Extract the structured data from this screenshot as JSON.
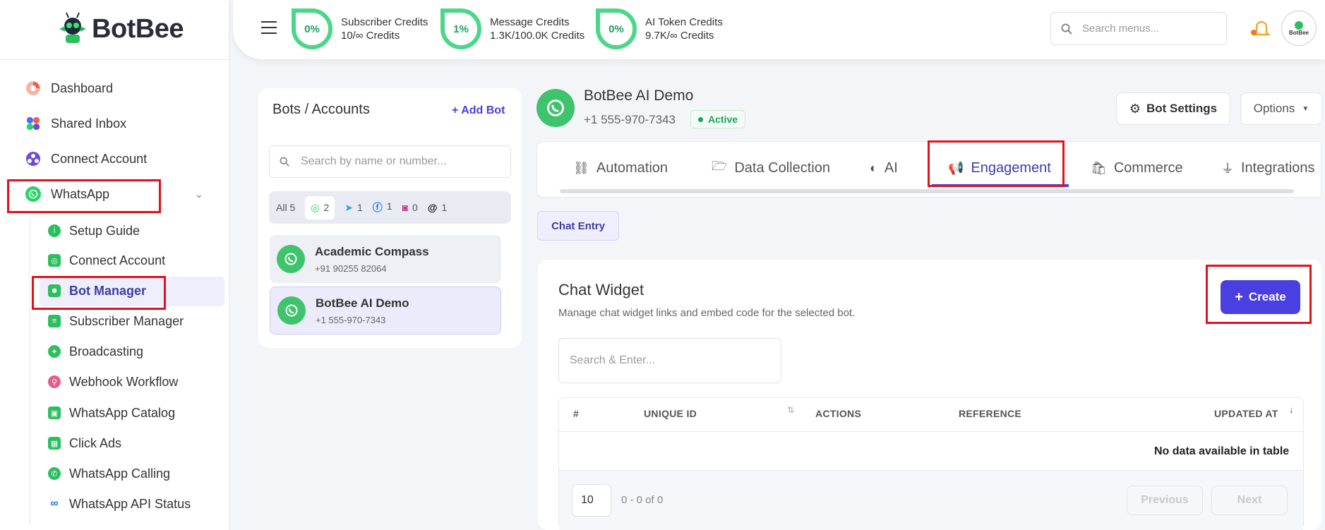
{
  "brand": {
    "name": "BotBee",
    "avatar_text": "BotBee"
  },
  "sidebar": {
    "items": [
      {
        "label": "Dashboard",
        "icon": "dashboard-icon",
        "color": "#f25c54"
      },
      {
        "label": "Shared Inbox",
        "icon": "shared-inbox-icon",
        "color": "#4a6cf7"
      },
      {
        "label": "Connect Account",
        "icon": "connect-account-icon",
        "color": "#6c4cd6"
      },
      {
        "label": "WhatsApp",
        "icon": "whatsapp-icon",
        "color": "#25d366"
      }
    ],
    "whatsapp_sub": [
      {
        "label": "Setup Guide",
        "icon": "info-icon",
        "color": "#2bbf5e"
      },
      {
        "label": "Connect Account",
        "icon": "connect-icon",
        "color": "#2bbf5e"
      },
      {
        "label": "Bot Manager",
        "icon": "robot-icon",
        "color": "#2bbf5e"
      },
      {
        "label": "Subscriber Manager",
        "icon": "subscriber-icon",
        "color": "#2bbf5e"
      },
      {
        "label": "Broadcasting",
        "icon": "broadcast-icon",
        "color": "#2bbf5e"
      },
      {
        "label": "Webhook Workflow",
        "icon": "webhook-icon",
        "color": "#e35d8b"
      },
      {
        "label": "WhatsApp Catalog",
        "icon": "catalog-icon",
        "color": "#2bbf5e"
      },
      {
        "label": "Click Ads",
        "icon": "click-ads-icon",
        "color": "#2bbf5e"
      },
      {
        "label": "WhatsApp Calling",
        "icon": "calling-icon",
        "color": "#2bbf5e"
      },
      {
        "label": "WhatsApp API Status",
        "icon": "meta-icon",
        "color": "#1877f2"
      }
    ]
  },
  "topbar": {
    "credits": [
      {
        "percent": "0%",
        "title": "Subscriber Credits",
        "value": "10/∞ Credits"
      },
      {
        "percent": "1%",
        "title": "Message Credits",
        "value": "1.3K/100.0K Credits"
      },
      {
        "percent": "0%",
        "title": "AI Token Credits",
        "value": "9.7K/∞ Credits"
      }
    ],
    "search_placeholder": "Search menus..."
  },
  "bots": {
    "title": "Bots / Accounts",
    "add_label": "Add Bot",
    "search_placeholder": "Search by name or number...",
    "filters": [
      {
        "label": "All 5"
      },
      {
        "icon": "whatsapp-icon",
        "count": "2"
      },
      {
        "icon": "telegram-icon",
        "count": "1"
      },
      {
        "icon": "facebook-icon",
        "count": "1"
      },
      {
        "icon": "instagram-icon",
        "count": "0"
      },
      {
        "icon": "threads-icon",
        "count": "1"
      }
    ],
    "list": [
      {
        "name": "Academic Compass",
        "phone": "+91 90255 82064"
      },
      {
        "name": "BotBee AI Demo",
        "phone": "+1 555-970-7343"
      }
    ]
  },
  "bot_header": {
    "name": "BotBee AI Demo",
    "phone": "+1 555-970-7343",
    "status": "Active",
    "settings_label": "Bot Settings",
    "options_label": "Options"
  },
  "tabs": [
    {
      "label": "Automation",
      "icon": "automation-icon"
    },
    {
      "label": "Data Collection",
      "icon": "folder-icon"
    },
    {
      "label": "AI",
      "icon": "brain-icon"
    },
    {
      "label": "Engagement",
      "icon": "megaphone-icon"
    },
    {
      "label": "Commerce",
      "icon": "bag-icon"
    },
    {
      "label": "Integrations",
      "icon": "plug-icon"
    }
  ],
  "subtab": "Chat Entry",
  "widget": {
    "title": "Chat Widget",
    "subtitle": "Manage chat widget links and embed code for the selected bot.",
    "create_label": "Create",
    "search_placeholder": "Search & Enter...",
    "columns": [
      "#",
      "UNIQUE ID",
      "ACTIONS",
      "REFERENCE",
      "UPDATED AT"
    ],
    "empty": "No data available in table",
    "page_size": "10",
    "info": "0 - 0 of 0",
    "prev": "Previous",
    "next": "Next"
  },
  "colors": {
    "accent": "#4a3fe0",
    "green": "#3ec46d",
    "highlight": "#e3111b"
  }
}
